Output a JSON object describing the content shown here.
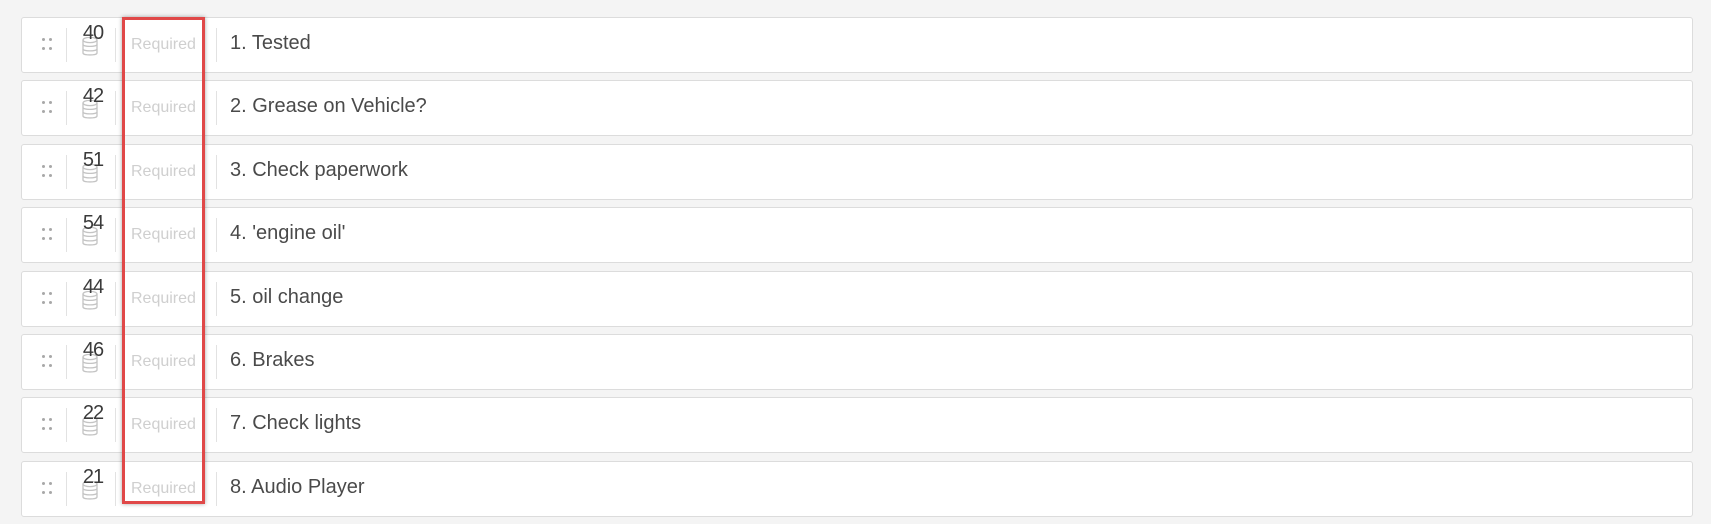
{
  "questions": [
    {
      "count": "40",
      "required_label": "Required",
      "label": "1. Tested"
    },
    {
      "count": "42",
      "required_label": "Required",
      "label": "2. Grease on Vehicle?"
    },
    {
      "count": "51",
      "required_label": "Required",
      "label": "3. Check paperwork"
    },
    {
      "count": "54",
      "required_label": "Required",
      "label": "4. 'engine oil'"
    },
    {
      "count": "44",
      "required_label": "Required",
      "label": "5. oil change"
    },
    {
      "count": "46",
      "required_label": "Required",
      "label": "6. Brakes"
    },
    {
      "count": "22",
      "required_label": "Required",
      "label": "7. Check lights"
    },
    {
      "count": "21",
      "required_label": "Required",
      "label": "8. Audio Player"
    }
  ],
  "icons": {
    "drag": "drag-handle-icon",
    "database": "database-icon"
  },
  "colors": {
    "highlight": "#e04848",
    "required_text": "#cfcfcf",
    "label_text": "#4a4a4a"
  }
}
